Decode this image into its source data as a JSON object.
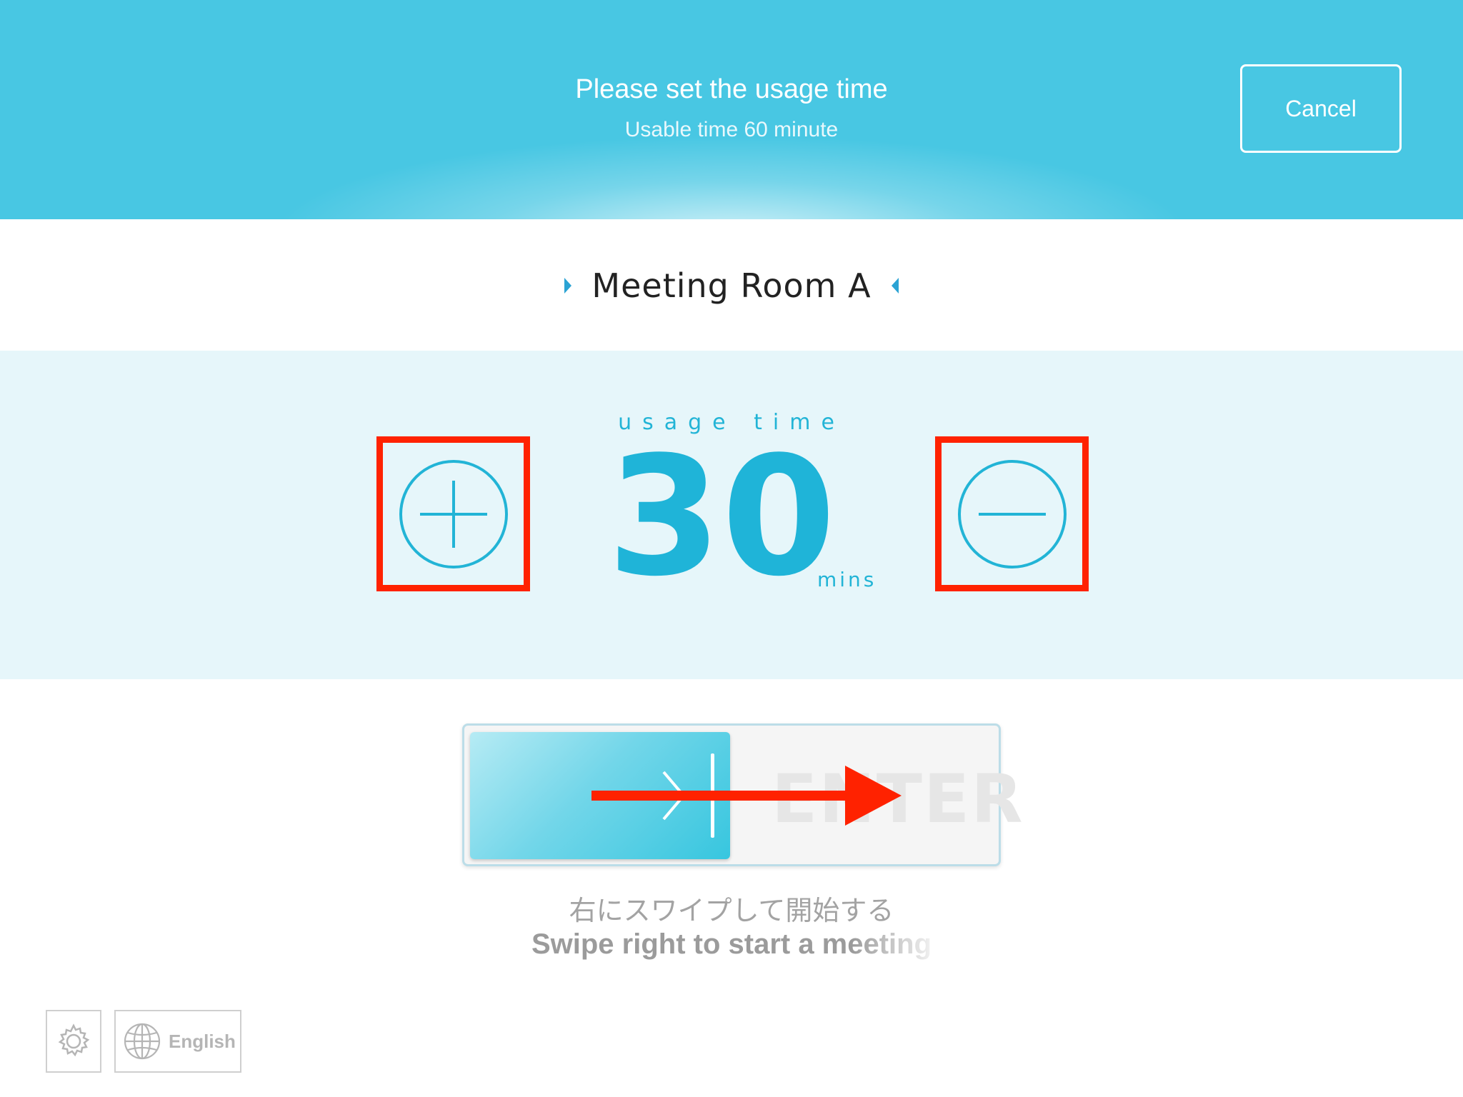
{
  "header": {
    "title": "Please set the usage time",
    "subtitle": "Usable time 60 minute",
    "cancel_label": "Cancel"
  },
  "room": {
    "name": "Meeting Room A"
  },
  "usage": {
    "label": "usage time",
    "value": "30",
    "unit": "mins"
  },
  "slider": {
    "label": "ENTER"
  },
  "hint": {
    "jp": "右にスワイプして開始する",
    "en": "Swipe right to start a meeting"
  },
  "footer": {
    "language_label": "English"
  },
  "colors": {
    "header_bg": "#48c7e3",
    "accent": "#1fb4d8",
    "panel_bg": "#e6f6fa",
    "highlight": "#ff2200"
  },
  "icons": {
    "increase": "plus-circle-icon",
    "decrease": "minus-circle-icon",
    "settings": "gear-icon",
    "language": "globe-icon"
  }
}
